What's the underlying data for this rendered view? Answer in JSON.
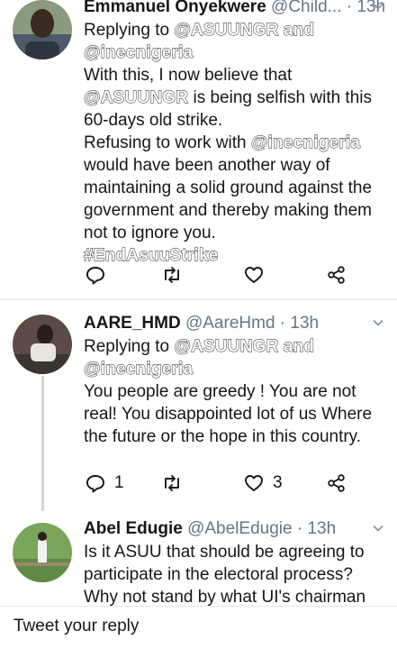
{
  "tweets": [
    {
      "name": "Emmanuel Onyekwere",
      "handle": "@Child...",
      "time": "13h",
      "replying_label": "Replying to",
      "mention1": "@ASUUNGR",
      "and_word": "and",
      "mention2": "@inecnigeria",
      "p1a": "With this, I now believe that",
      "p1m": "@ASUUNGR",
      "p1b": "is being selfish with this 60-days old strike.",
      "p2a": "Refusing to work with",
      "p2m": "@inecnigeria",
      "p2b": "would have been another way of maintaining a solid ground against the government and thereby making them not to ignore you.",
      "hashtag": "#EndAsuuStrike"
    },
    {
      "name": "AARE_HMD",
      "handle": "@AareHmd",
      "time": "13h",
      "replying_label": "Replying to",
      "mention1": "@ASUUNGR",
      "and_word": "and",
      "mention2": "@inecnigeria",
      "body": "You people are greedy ! You are not real! You disappointed lot of us Where the future or the hope in this country.",
      "reply_count": "1",
      "like_count": "3"
    },
    {
      "name": "Abel Edugie",
      "handle": "@AbelEdugie",
      "time": "13h",
      "body": "Is it ASUU that should be agreeing to participate in the electoral process? Why not stand by what UI's chairman said?"
    }
  ],
  "reply_bar": {
    "placeholder": "Tweet your reply"
  },
  "icons": [
    "reply-icon",
    "retweet-icon",
    "like-icon",
    "share-icon",
    "chevron-down-icon"
  ],
  "colors": {
    "text": "#14171a",
    "secondary": "#657786",
    "divider": "#e1e8ed",
    "thread": "#ccd6dd"
  }
}
